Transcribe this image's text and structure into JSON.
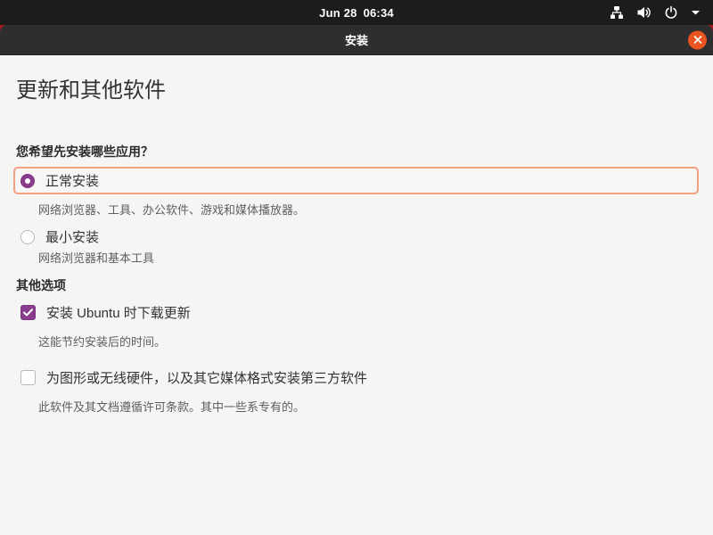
{
  "topbar": {
    "date": "Jun 28",
    "time": "06:34"
  },
  "titlebar": {
    "title": "安装"
  },
  "page": {
    "heading": "更新和其他软件"
  },
  "main": {
    "question": "您希望先安装哪些应用？",
    "primary_options": [
      {
        "label": "正常安装",
        "description": "网络浏览器、工具、办公软件、游戏和媒体播放器。",
        "selected": true
      },
      {
        "label": "最小安装",
        "description": "网络浏览器和基本工具",
        "selected": false
      }
    ],
    "other_options_heading": "其他选项",
    "other_options": [
      {
        "label": "安装 Ubuntu 时下载更新",
        "description": "这能节约安装后的时间。",
        "checked": true
      },
      {
        "label": "为图形或无线硬件，以及其它媒体格式安装第三方软件",
        "description": "此软件及其文档遵循许可条款。其中一些系专有的。",
        "checked": false
      }
    ]
  },
  "colors": {
    "accent_orange": "#e95420",
    "focus_ring": "#f2a182",
    "control_purple": "#8a3d8c",
    "topbar_bg": "#1c1c1c",
    "titlebar_bg": "#2e2e30",
    "content_bg": "#f5f5f4"
  }
}
